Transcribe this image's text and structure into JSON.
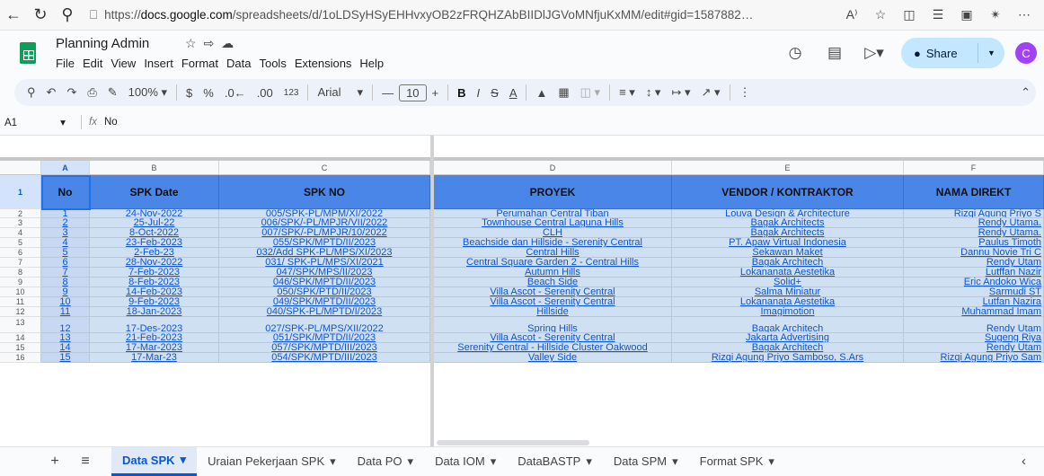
{
  "browser": {
    "url_prefix": "https://",
    "url_host": "docs.google.com",
    "url_path": "/spreadsheets/d/1oLDSyHSyEHHvxyOB2zFRQHZAbBIIDlJGVoMNfjuKxMM/edit#gid=1587882…",
    "reader_label": "A⁾"
  },
  "doc": {
    "title": "Planning Admin",
    "menus": [
      "File",
      "Edit",
      "View",
      "Insert",
      "Format",
      "Data",
      "Tools",
      "Extensions",
      "Help"
    ],
    "share_label": "Share",
    "avatar_letter": "C"
  },
  "toolbar": {
    "zoom": "100%",
    "currency": "$",
    "percent": "%",
    "dec_decrease": ".0←",
    "dec_increase": ".00",
    "number_format": "123",
    "font": "Arial",
    "font_size": "10",
    "bold": "B",
    "italic": "I",
    "strike": "S",
    "text_color": "A"
  },
  "formula_bar": {
    "cell_ref": "A1",
    "fx": "fx",
    "value": "No"
  },
  "columns": [
    {
      "letter": "A",
      "header": "No"
    },
    {
      "letter": "B",
      "header": "SPK Date"
    },
    {
      "letter": "C",
      "header": "SPK NO"
    },
    {
      "letter": "D",
      "header": "PROYEK"
    },
    {
      "letter": "E",
      "header": "VENDOR / KONTRAKTOR"
    },
    {
      "letter": "F",
      "header": "NAMA DIREKT"
    }
  ],
  "header_row_number": "1",
  "rows": [
    {
      "n": "2",
      "no": "1",
      "date": "24-Nov-2022",
      "spk": "005/SPK-PL/MPM/XI/2022",
      "proyek": "Perumahan Central Tiban",
      "vendor": "Louva Design & Architecture",
      "direktur": "Rizqi Agung Priyo S"
    },
    {
      "n": "3",
      "no": "2",
      "date": "25-Jul-22",
      "spk": "006/SPK/-PL/MPJR/VII/2022",
      "proyek": "Townhouse Central Laguna Hills",
      "vendor": "Bagak Architects",
      "direktur": "Rendy Utama."
    },
    {
      "n": "4",
      "no": "3",
      "date": "8-Oct-2022",
      "spk": "007/SPK/-PL/MPJR/10/2022",
      "proyek": "CLH",
      "vendor": "Bagak Architects",
      "direktur": "Rendy Utama."
    },
    {
      "n": "5",
      "no": "4",
      "date": "23-Feb-2023",
      "spk": "055/SPK/MPTD/II/2023",
      "proyek": "Beachside dan Hillside - Serenity Central",
      "vendor": "PT. Apaw Virtual Indonesia",
      "direktur": "Paulus Timoth"
    },
    {
      "n": "6",
      "no": "5",
      "date": "2-Feb-23",
      "spk": "032/Add SPK-PL/MPS/XI/2023",
      "proyek": "Central Hills",
      "vendor": "Sekawan Maket",
      "direktur": "Dannu Novie Tri C"
    },
    {
      "n": "7",
      "no": "6",
      "date": "28-Nov-2022",
      "spk": "031/ SPK-PL/MPS/XI/2021",
      "proyek": "Central Square Garden 2 - Central Hills",
      "vendor": "Bagak Architech",
      "direktur": "Rendy Utam"
    },
    {
      "n": "8",
      "no": "7",
      "date": "7-Feb-2023",
      "spk": "047/SPK/MPS/II/2023",
      "proyek": "Autumn Hills",
      "vendor": "Lokananata Aestetika",
      "direktur": "Lutffan Nazir"
    },
    {
      "n": "9",
      "no": "8",
      "date": "8-Feb-2023",
      "spk": "046/SPK/MPTD/II/2023",
      "proyek": "Beach Side",
      "vendor": "Solid+",
      "direktur": "Eric Andoko Wica"
    },
    {
      "n": "10",
      "no": "9",
      "date": "14-Feb-2023",
      "spk": "050/SPK/PTD/II/2023",
      "proyek": "Villa Ascot - Serenity Central",
      "vendor": "Salma Miniatur",
      "direktur": "Sarmudi ST"
    },
    {
      "n": "11",
      "no": "10",
      "date": "9-Feb-2023",
      "spk": "049/SPK/MPTD/II/2023",
      "proyek": "Villa Ascot - Serenity Central",
      "vendor": "Lokananata Aestetika",
      "direktur": "Lutfan Nazira"
    },
    {
      "n": "12",
      "no": "11",
      "date": "18-Jan-2023",
      "spk": "040/SPK-PL/MPTD/I/2023",
      "proyek": "Hillside",
      "vendor": "Imagimotion",
      "direktur": "Muhammad Imam"
    },
    {
      "n": "13",
      "no": "12",
      "date": "17-Des-2023",
      "spk": "027/SPK-PL/MPS/XII/2022",
      "proyek": "Spring Hills",
      "vendor": "Bagak Architech",
      "direktur": "Rendy Utam"
    },
    {
      "n": "14",
      "no": "13",
      "date": "21-Feb-2023",
      "spk": "051/SPK/MPTD/II/2023",
      "proyek": "Villa Ascot - Serenity Central",
      "vendor": "Jakarta Advertising",
      "direktur": "Sugeng Riya"
    },
    {
      "n": "15",
      "no": "14",
      "date": "17-Mar-2023",
      "spk": "057/SPK/MPTD/III/2023",
      "proyek": "Serenity Central - Hillside Cluster Oakwood",
      "vendor": "Bagak Architech",
      "direktur": "Rendy Utam"
    },
    {
      "n": "16",
      "no": "15",
      "date": "17-Mar-23",
      "spk": "054/SPK/MPTD/III/2023",
      "proyek": "Valley Side",
      "vendor": "Rizqi Agung Priyo Samboso, S.Ars",
      "direktur": "Rizqi Agung Priyo Sam"
    }
  ],
  "sheet_tabs": [
    "Data SPK",
    "Uraian Pekerjaan SPK",
    "Data PO",
    "Data IOM",
    "DataBASTP",
    "Data SPM",
    "Format SPK"
  ],
  "active_tab_index": 0,
  "colors": {
    "header_fill": "#4a86e8",
    "body_fill": "#cfe0f3",
    "link_text": "#1155cc",
    "share_button": "#c2e7ff",
    "avatar": "#a142f4"
  }
}
